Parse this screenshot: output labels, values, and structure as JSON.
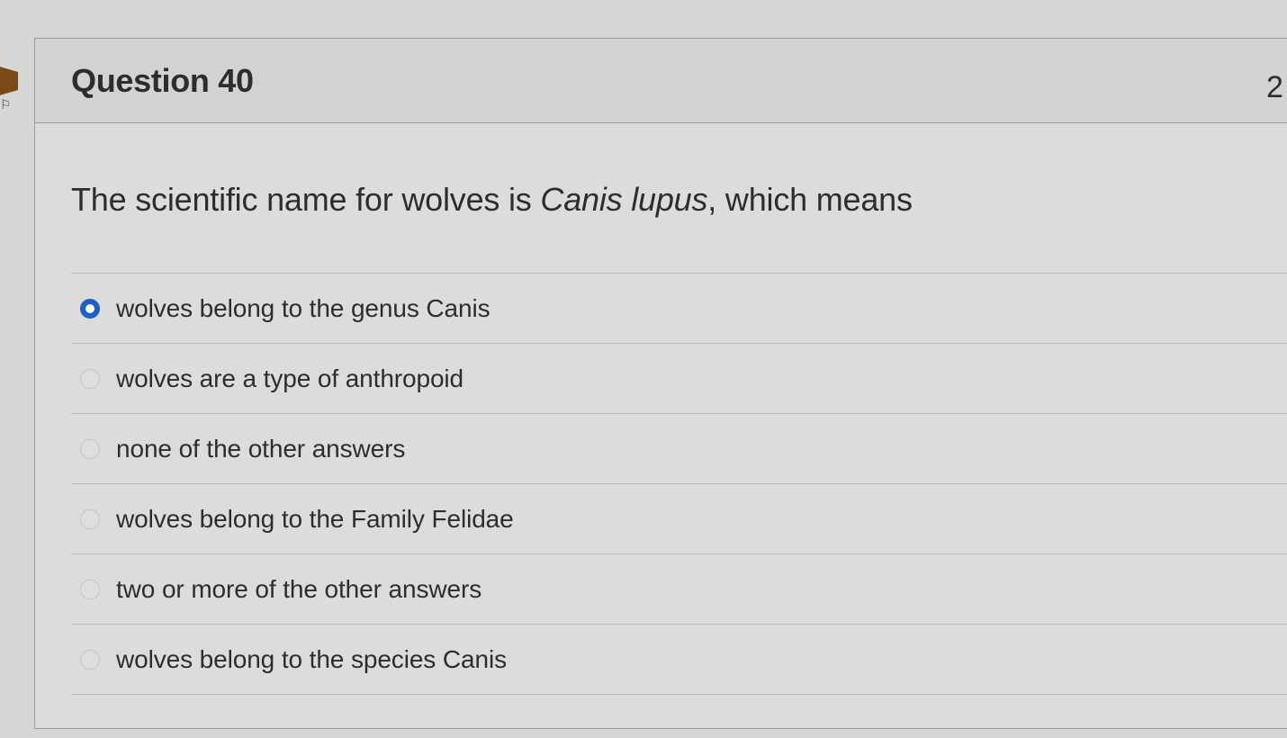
{
  "question": {
    "title": "Question 40",
    "points_partial": "2",
    "text_before": "The scientific name for wolves is ",
    "text_italic": "Canis lupus",
    "text_after": ", which means"
  },
  "answers": [
    {
      "label": "wolves belong to the genus Canis",
      "selected": true
    },
    {
      "label": "wolves are a type of anthropoid",
      "selected": false
    },
    {
      "label": "none of the other answers",
      "selected": false
    },
    {
      "label": "wolves belong to the Family Felidae",
      "selected": false
    },
    {
      "label": "two or more of the other answers",
      "selected": false
    },
    {
      "label": "wolves belong to the species Canis",
      "selected": false
    }
  ],
  "colors": {
    "selected_radio": "#1b5fc9",
    "text": "#2d2d2d",
    "background": "#d6d6d4"
  }
}
